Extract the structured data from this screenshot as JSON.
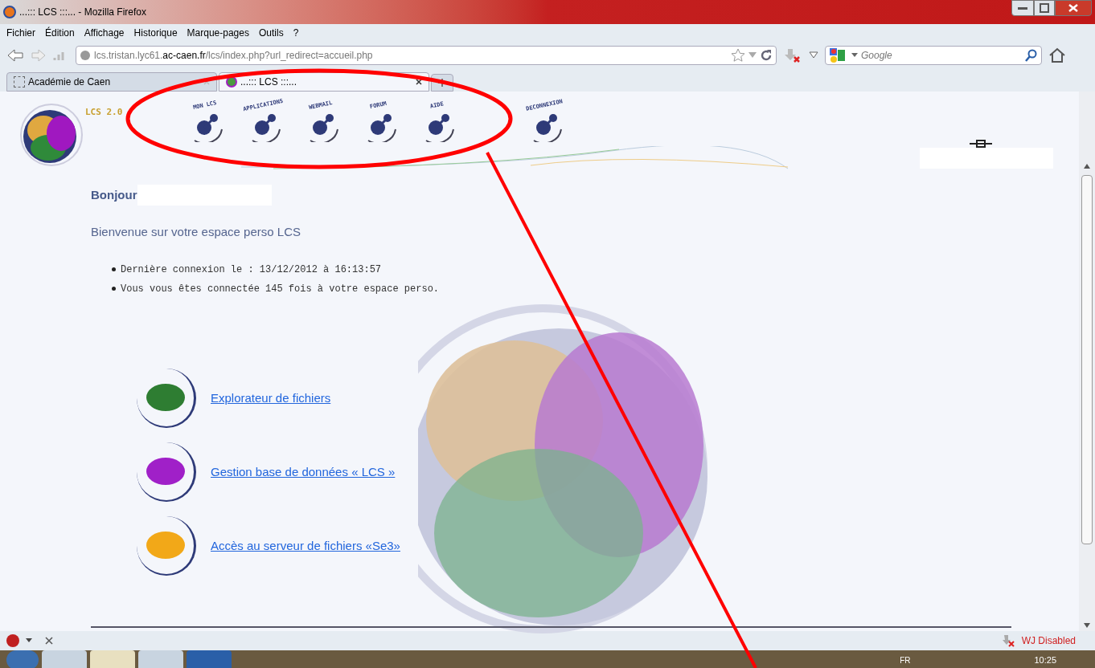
{
  "window": {
    "title": "...::: LCS :::... - Mozilla Firefox"
  },
  "menu": [
    "Fichier",
    "Édition",
    "Affichage",
    "Historique",
    "Marque-pages",
    "Outils",
    "?"
  ],
  "address": {
    "value": "lcs.tristan.lyc61.**ac-caen.fr**/lcs/index.php?url_redirect=accueil.php"
  },
  "search": {
    "placeholder": "Google"
  },
  "tabs": [
    {
      "label": "Académie de Caen",
      "selected": false
    },
    {
      "label": "...::: LCS :::...",
      "selected": true
    }
  ],
  "page": {
    "logo_text": "LCS 2.0",
    "nav": [
      "MON LCS",
      "APPLICATIONS",
      "WEBMAIL",
      "FORUM",
      "AIDE"
    ],
    "logout": "DECONNEXION",
    "greeting": "Bonjour",
    "welcome": "Bienvenue sur votre espace perso LCS",
    "info": [
      "Dernière connexion le : 13/12/2012 à 16:13:57",
      "Vous vous êtes connectée 145 fois à votre espace perso."
    ],
    "links": [
      {
        "label": "Explorateur de fichiers",
        "color": "#2e7d32"
      },
      {
        "label": "Gestion base de données « LCS »",
        "color": "#a020c8"
      },
      {
        "label": "Accès au serveur de fichiers «Se3»",
        "color": "#f2a818"
      }
    ]
  },
  "status_bar": {
    "addon": "WJ Disabled"
  },
  "taskbar": {
    "language": "FR",
    "clock": "10:25"
  }
}
